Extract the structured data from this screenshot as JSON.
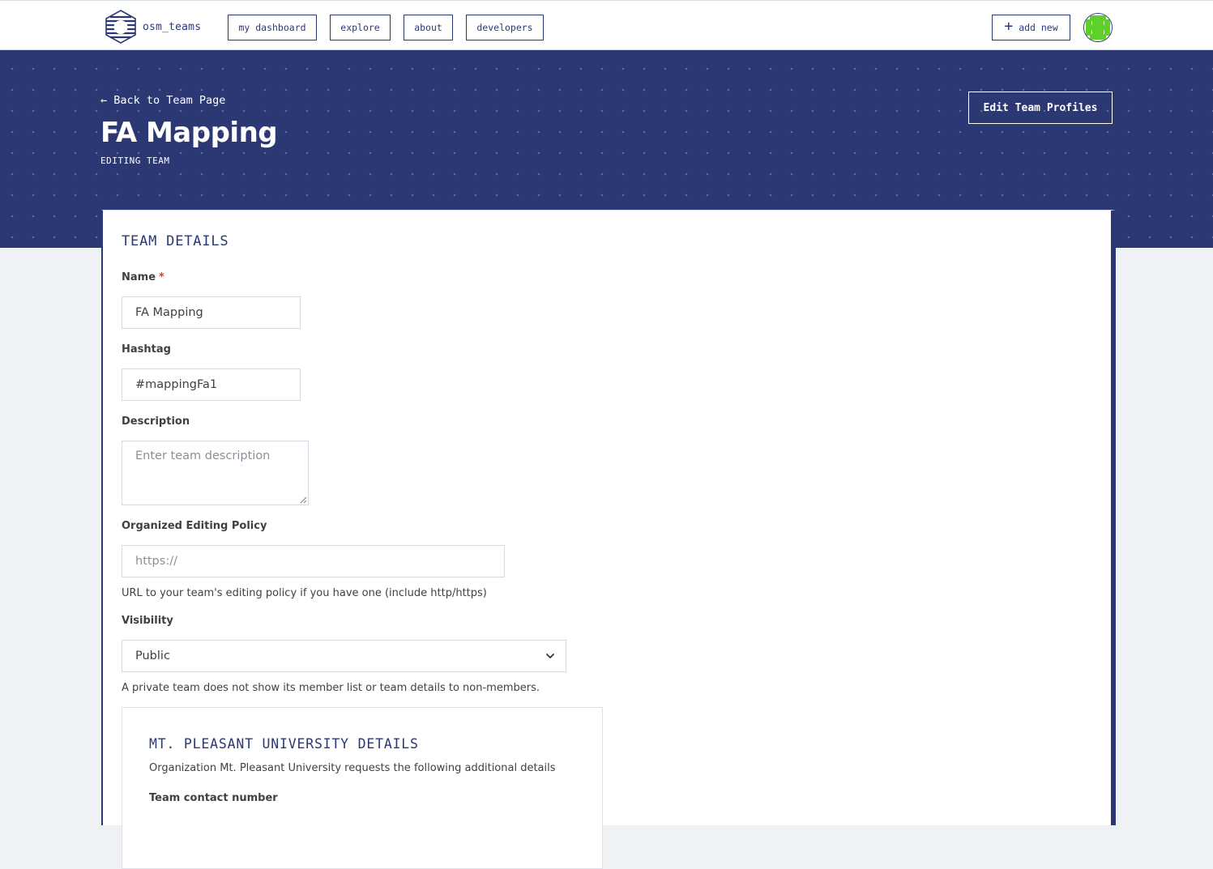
{
  "nav": {
    "brand_name": "osm_teams",
    "links": [
      {
        "label": "my dashboard"
      },
      {
        "label": "explore"
      },
      {
        "label": "about"
      },
      {
        "label": "developers"
      }
    ],
    "add_new_label": "add new"
  },
  "hero": {
    "back_link": "← Back to Team Page",
    "title": "FA Mapping",
    "subtitle": "EDITING TEAM",
    "edit_profiles_label": "Edit Team Profiles"
  },
  "form": {
    "section_title": "TEAM DETAILS",
    "name": {
      "label": "Name",
      "required_mark": "*",
      "value": "FA Mapping"
    },
    "hashtag": {
      "label": "Hashtag",
      "value": "#mappingFa1"
    },
    "description": {
      "label": "Description",
      "placeholder": "Enter team description"
    },
    "editing_policy": {
      "label": "Organized Editing Policy",
      "placeholder": "https://",
      "help": "URL to your team's editing policy if you have one (include http/https)"
    },
    "visibility": {
      "label": "Visibility",
      "selected": "Public",
      "help": "A private team does not show its member list or team details to non-members."
    }
  },
  "org_details": {
    "title": "MT. PLEASANT UNIVERSITY DETAILS",
    "intro": "Organization Mt. Pleasant University requests the following additional details",
    "contact_label": "Team contact number"
  },
  "colors": {
    "primary": "#2c3873",
    "required": "#d63a3a",
    "avatar_accent": "#5fcf2a"
  },
  "icons": {
    "logo": "osm-teams-logo-icon",
    "add": "plus-icon",
    "avatar": "identicon-avatar-icon",
    "select": "chevron-down-icon"
  }
}
